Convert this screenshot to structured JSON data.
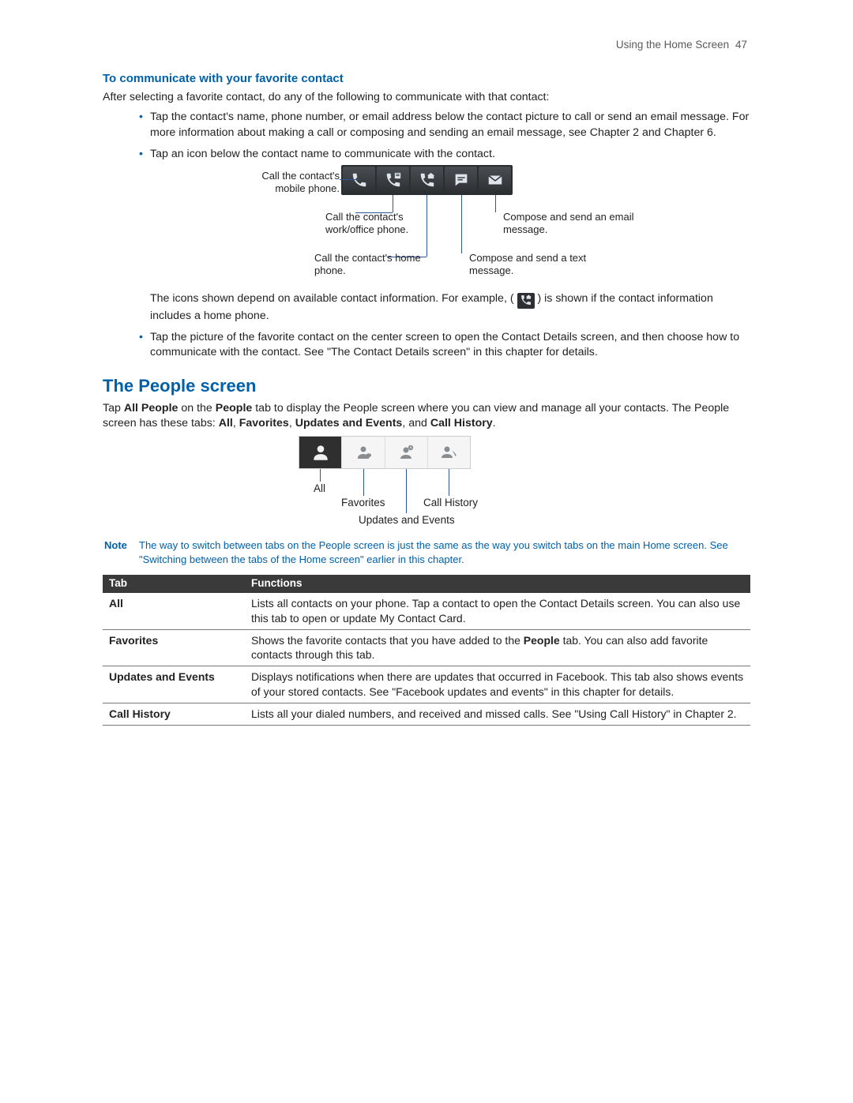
{
  "header": {
    "running": "Using the Home Screen",
    "page": "47"
  },
  "sub1": {
    "title": "To communicate with your favorite contact",
    "intro": "After selecting a favorite contact, do any of the following to communicate with that contact:",
    "b1": "Tap the contact's name, phone number, or email address below the contact picture to call or send an email message. For more information about making a call or composing and sending an email message, see Chapter 2 and Chapter 6.",
    "b2": "Tap an icon below the contact name to communicate with the contact.",
    "d": {
      "mobile": "Call the contact's mobile phone.",
      "work": "Call the contact's work/office phone.",
      "home": "Call the contact's home phone.",
      "sms": "Compose and send a text message.",
      "email": "Compose and send an email message."
    },
    "after1a": "The icons shown depend on available contact information. For example, (",
    "after1b": ") is shown if the contact information includes a home phone.",
    "b3": "Tap the picture of the favorite contact on the center screen to open the Contact Details screen, and then choose how to communicate with the contact. See \"The Contact Details screen\" in this chapter for details."
  },
  "section": {
    "title": "The People screen",
    "p1a": "Tap ",
    "p1b": "All People",
    "p1c": " on the ",
    "p1d": "People",
    "p1e": " tab to display the People screen where you can view and manage all your contacts. The People screen has these tabs: ",
    "p1f": "All",
    "p1g": ", ",
    "p1h": "Favorites",
    "p1i": ", ",
    "p1j": "Updates and Events",
    "p1k": ", and ",
    "p1l": "Call History",
    "p1m": ".",
    "tabs": {
      "all": "All",
      "favorites": "Favorites",
      "updates": "Updates and Events",
      "callhist": "Call History"
    },
    "note": {
      "label": "Note",
      "text": "The way to switch between tabs on the People screen is just the same as the way you switch tabs on the main Home screen. See \"Switching between the tabs of the Home screen\" earlier in this chapter."
    },
    "table": {
      "h1": "Tab",
      "h2": "Functions",
      "rows": [
        {
          "tab": "All",
          "fn": "Lists all contacts on your phone. Tap a contact to open the Contact Details screen. You can also use this tab to open or update My Contact Card."
        },
        {
          "tab": "Favorites",
          "fn_a": "Shows the favorite contacts that you have added to the ",
          "fn_b": "People",
          "fn_c": " tab. You can also add favorite contacts through this tab."
        },
        {
          "tab": "Updates and Events",
          "fn": "Displays notifications when there are updates that occurred in Facebook. This tab also shows events of your stored contacts. See \"Facebook updates and events\" in this chapter for details."
        },
        {
          "tab": "Call History",
          "fn": "Lists all your dialed numbers, and received and missed calls. See \"Using Call History\" in Chapter 2."
        }
      ]
    }
  }
}
